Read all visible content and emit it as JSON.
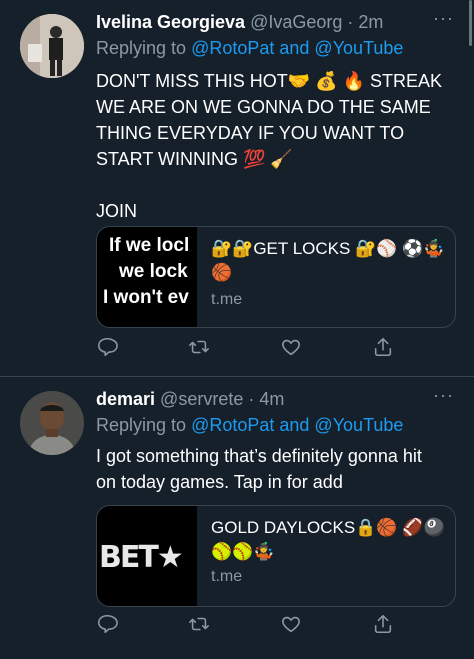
{
  "tweets": [
    {
      "name": "Ivelina Georgieva",
      "handle": "@IvaGeorg",
      "time": "· 2m",
      "replying_prefix": "Replying to ",
      "mention1": "@RotoPat",
      "and": " and ",
      "mention2": "@YouTube",
      "text": "DON'T MISS THIS HOT🤝 💰 🔥 STREAK\nWE ARE ON WE GONNA DO THE SAME\nTHING EVERYDAY IF YOU WANT TO\nSTART WINNING 💯 🧹\n\nJOIN",
      "card": {
        "title": "🔐🔐GET LOCKS 🔐⚾ ⚽🤹🏀",
        "domain": "t.me",
        "image_lines": [
          "If we locl",
          "we lock",
          "I won't ev"
        ]
      }
    },
    {
      "name": "demari",
      "handle": "@servrete",
      "time": "· 4m",
      "replying_prefix": "Replying to ",
      "mention1": "@RotoPat",
      "and": " and ",
      "mention2": "@YouTube",
      "text": "I got something that’s definitely gonna hit\non today games. Tap in for add",
      "card": {
        "title": "GOLD DAYLOCKS🔒🏀 🏈🎱🥎🥎🤹",
        "domain": "t.me",
        "image_text": "BET★"
      }
    }
  ],
  "more_icon": "···",
  "icons": [
    "reply-icon",
    "retweet-icon",
    "like-icon",
    "share-icon"
  ],
  "colors": {
    "background": "#15202b",
    "link": "#1d9bf0",
    "muted": "#8b98a5",
    "border": "#38444d"
  }
}
